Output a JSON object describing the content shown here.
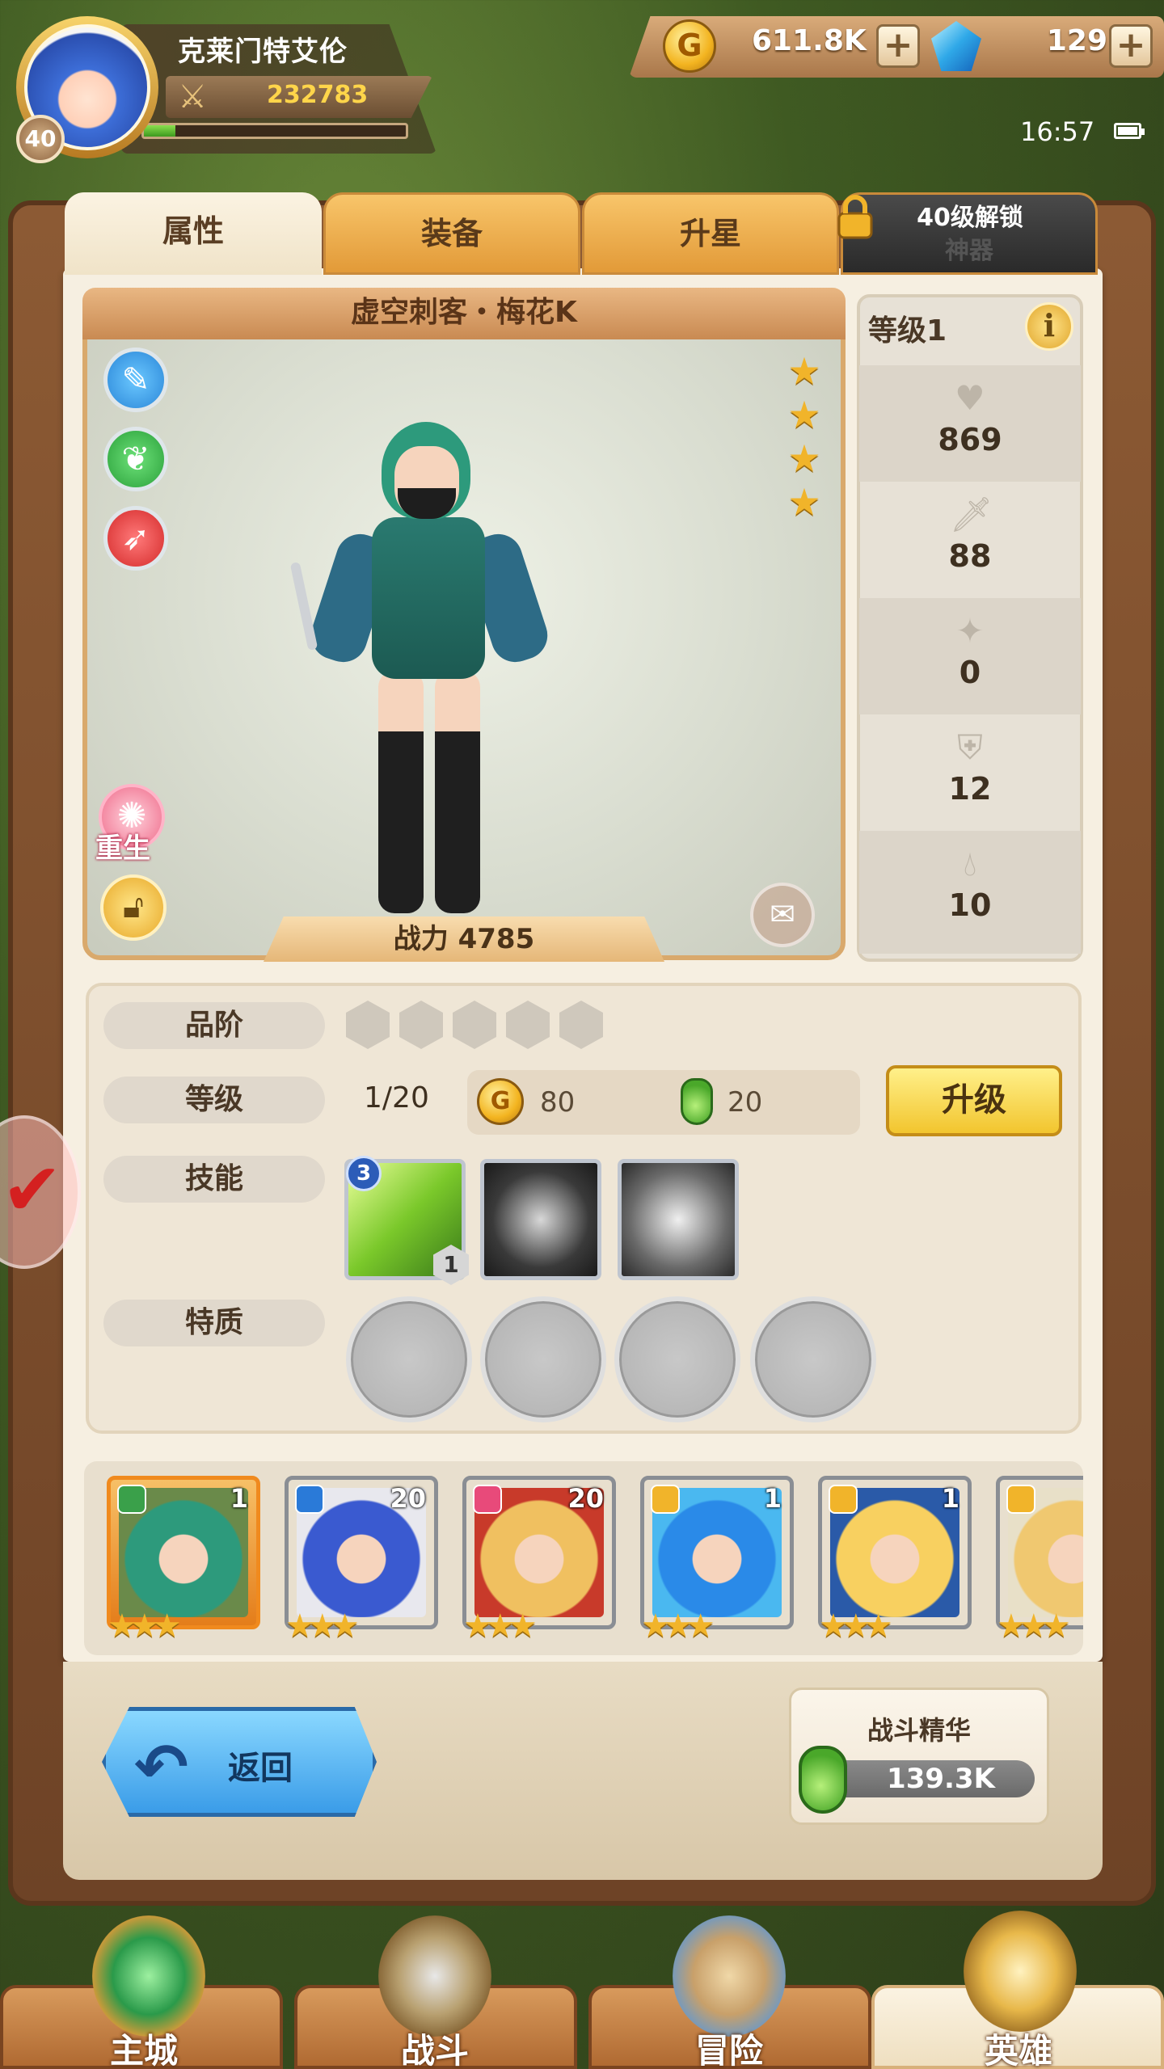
{
  "player": {
    "name": "克莱门特艾伦",
    "level": "40",
    "power": "232783",
    "xp_fraction": 0.12
  },
  "currency": {
    "gold": "611.8K",
    "gems": "129",
    "gold_icon_glyph": "G"
  },
  "status": {
    "time": "16:57"
  },
  "tabs": [
    {
      "label": "属性",
      "active": true
    },
    {
      "label": "装备"
    },
    {
      "label": "升星"
    },
    {
      "label": "神器",
      "locked_label": "40级解锁"
    }
  ],
  "hero": {
    "title": "虚空刺客・梅花K",
    "stars": 4,
    "power_label": "战力 4785",
    "rebirth_label": "重生",
    "class_icons": [
      "dagger-icon",
      "wolf-icon",
      "rocket-icon"
    ]
  },
  "stats": {
    "level_label": "等级1",
    "info_glyph": "i",
    "rows": [
      {
        "icon": "heart-icon",
        "value": "869"
      },
      {
        "icon": "sword-icon",
        "value": "88"
      },
      {
        "icon": "shuriken-icon",
        "value": "0"
      },
      {
        "icon": "shield-icon",
        "value": "12"
      },
      {
        "icon": "drop-icon",
        "value": "10"
      }
    ]
  },
  "info": {
    "grade_label": "品阶",
    "level_label": "等级",
    "level_value": "1/20",
    "gold_cost": "80",
    "essence_cost": "20",
    "upgrade_label": "升级",
    "skill_label": "技能",
    "skill_badge": "3",
    "skill_level": "1",
    "trait_label": "特质"
  },
  "roster": [
    {
      "level": "1",
      "selected": true,
      "stars": "★★★"
    },
    {
      "level": "20",
      "stars": "★★★"
    },
    {
      "level": "20",
      "stars": "★★★"
    },
    {
      "level": "1",
      "stars": "★★★"
    },
    {
      "level": "1",
      "stars": "★★★"
    },
    {
      "level": "",
      "stars": "★★★"
    }
  ],
  "bottom": {
    "back_label": "返回",
    "essence_title": "战斗精华",
    "essence_value": "139.3K"
  },
  "nav": [
    {
      "label": "主城"
    },
    {
      "label": "战斗"
    },
    {
      "label": "冒险"
    },
    {
      "label": "英雄",
      "active": true
    }
  ],
  "colors": {
    "accent_gold": "#f1b42a",
    "upgrade_yellow": "#f2c52e",
    "back_blue": "#3a9ce8"
  }
}
